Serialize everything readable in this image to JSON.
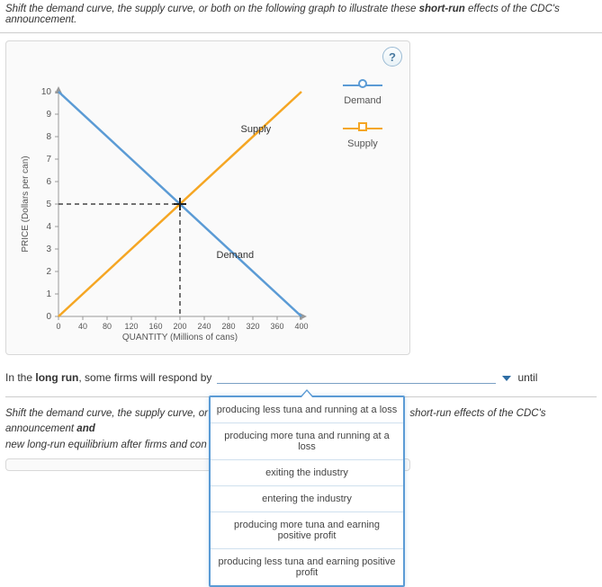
{
  "instruction": {
    "pre": "Shift the demand curve, the supply curve, or both on the following graph to illustrate these ",
    "bold": "short-run",
    "post": " effects of the CDC's announcement."
  },
  "help_label": "?",
  "chart_data": {
    "type": "line",
    "title": "",
    "xlabel": "QUANTITY (Millions of cans)",
    "ylabel": "PRICE (Dollars per can)",
    "xlim": [
      0,
      400
    ],
    "ylim": [
      0,
      10
    ],
    "xticks": [
      0,
      40,
      80,
      120,
      160,
      200,
      240,
      280,
      320,
      360,
      400
    ],
    "yticks": [
      0,
      1,
      2,
      3,
      4,
      5,
      6,
      7,
      8,
      9,
      10
    ],
    "series": [
      {
        "name": "Demand",
        "color": "#5b9bd5",
        "points": [
          [
            0,
            10
          ],
          [
            400,
            0
          ]
        ]
      },
      {
        "name": "Supply",
        "color": "#f5a623",
        "points": [
          [
            0,
            0
          ],
          [
            400,
            10
          ]
        ]
      }
    ],
    "labels": [
      {
        "text": "Supply",
        "x": 300,
        "y": 8.2
      },
      {
        "text": "Demand",
        "x": 260,
        "y": 2.6
      }
    ],
    "equilibrium": {
      "x": 200,
      "y": 5
    },
    "legend": [
      {
        "name": "Demand",
        "color": "#5b9bd5",
        "shape": "circle"
      },
      {
        "name": "Supply",
        "color": "#f5a623",
        "shape": "square"
      }
    ]
  },
  "sentence": {
    "pre": "In the ",
    "bold": "long run",
    "mid": ", some firms will respond by",
    "after": "until"
  },
  "dropdown": {
    "options": [
      "producing less tuna and running at a loss",
      "producing more tuna and running at a loss",
      "exiting the industry",
      "entering the industry",
      "producing more tuna and earning positive profit",
      "producing less tuna and earning positive profit"
    ]
  },
  "cut_text": {
    "line1_pre": "Shift the demand curve, the supply curve, or",
    "line1_post_pre": "short-run effects of the CDC's announcement ",
    "line1_post_bold": "and",
    "line2": "new long-run equilibrium after firms and con"
  }
}
